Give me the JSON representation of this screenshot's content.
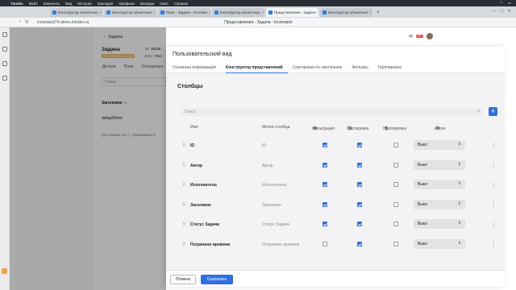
{
  "menubar": {
    "app": "Yandex",
    "items": [
      "Файл",
      "Изменить",
      "Вид",
      "История",
      "Закладки",
      "Профили",
      "Вкладки",
      "Окно",
      "Справка"
    ]
  },
  "browser": {
    "tabs": [
      {
        "label": "Конструктор объектных"
      },
      {
        "label": "Конструктор объектных"
      },
      {
        "label": "Поле - Задача - Incoman"
      },
      {
        "label": "Конструктор объектных"
      },
      {
        "label": "Представления - Задача"
      },
      {
        "label": "Конструктор объектных"
      }
    ],
    "active_tab": 4,
    "url": "incomand74-demo.elmdev.ru",
    "page_title": "Представления - Задача - Incomand"
  },
  "background": {
    "breadcrumb": "Задача",
    "title": "Задача",
    "badge": "ПОЛЬЗОВАТЕЛЬСКИЙ",
    "id_label": "ID:",
    "id_value": "19118",
    "esc_label": "ESC:",
    "esc_value": "Test",
    "tabs": [
      "Детали",
      "Поля",
      "Отношения"
    ],
    "search_placeholder": "Поиск",
    "col_header": "Заголовок",
    "row_value": "defaultView",
    "footer_text": "(29 элементов ↕)",
    "footer_text2": "Показывается",
    "notif_count": "99+"
  },
  "panel": {
    "title": "Пользовательский вид",
    "tabs": [
      {
        "label": "Основная информация",
        "active": false
      },
      {
        "label": "Конструктор представлений",
        "active": true
      },
      {
        "label": "Сортировка по умолчанию",
        "active": false
      },
      {
        "label": "Фильтры",
        "active": false
      },
      {
        "label": "Группировка",
        "active": false
      }
    ],
    "section_title": "Столбцы",
    "search_placeholder": "Поиск",
    "add_button": "+",
    "columns": {
      "name": "Имя",
      "label": "Метка столбца",
      "filter": "Фильтрация",
      "sort": "Сортировка",
      "group": "Группировка",
      "totals": "Итоги"
    },
    "rows": [
      {
        "name": "ID",
        "label": "ID",
        "filter": true,
        "sort": true,
        "group": false,
        "total": "Выкл"
      },
      {
        "name": "Автор",
        "label": "Автор",
        "filter": true,
        "sort": true,
        "group": false,
        "total": "Выкл"
      },
      {
        "name": "Исполнитель",
        "label": "Исполнитель",
        "filter": true,
        "sort": true,
        "group": false,
        "total": "Выкл"
      },
      {
        "name": "Заголовок",
        "label": "Заголовок",
        "filter": true,
        "sort": true,
        "group": false,
        "total": "Выкл"
      },
      {
        "name": "Статус Задачи",
        "label": "Статус Задачи",
        "filter": true,
        "sort": true,
        "group": false,
        "total": "Выкл"
      },
      {
        "name": "Потрачено времени",
        "label": "Потрачено времени",
        "filter": false,
        "sort": true,
        "group": false,
        "total": "Выкл"
      }
    ],
    "cancel_label": "Отмена",
    "save_label": "Сохранить"
  },
  "colors": {
    "accent": "#2f6fe0",
    "badge": "#f0b55b",
    "notif": "#e53935"
  }
}
